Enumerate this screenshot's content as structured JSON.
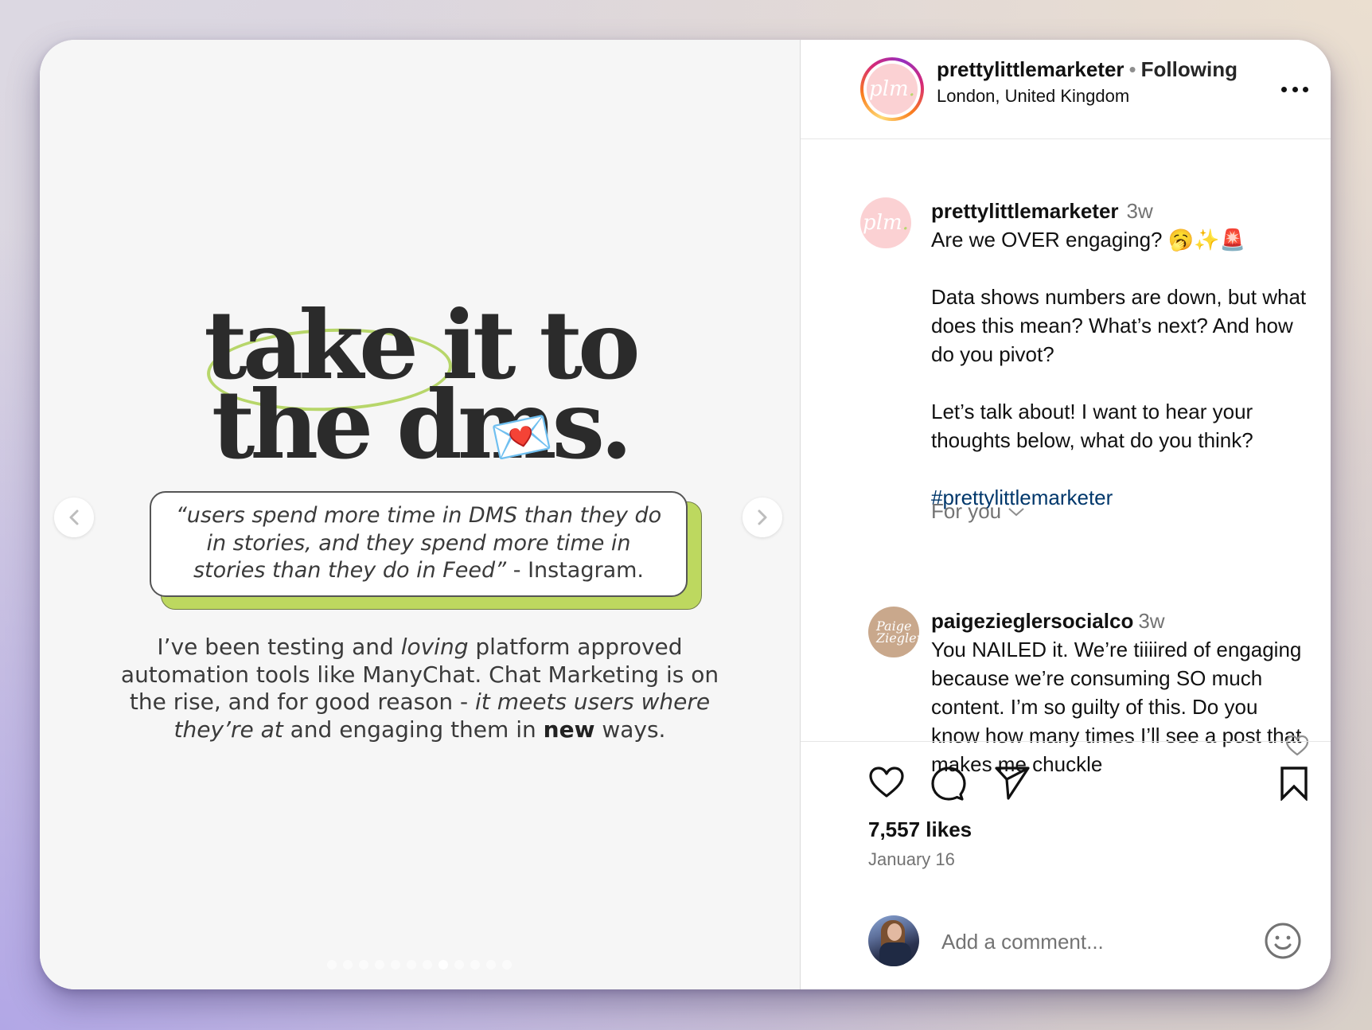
{
  "media": {
    "headline_line1": "take it to",
    "headline_line2": "the dms.",
    "sticker_emoji": "💌",
    "quote_text": "“users spend more time in DMS than they do in stories, and they spend more time in stories than they do in Feed”",
    "quote_attribution": " - Instagram.",
    "body_parts": [
      {
        "text": "I’ve been testing and ",
        "style": "normal"
      },
      {
        "text": "loving",
        "style": "italic"
      },
      {
        "text": " platform approved automation tools like ManyChat. Chat Marketing is on the rise, and for good reason - ",
        "style": "normal"
      },
      {
        "text": "it meets users where they’re at",
        "style": "italic"
      },
      {
        "text": " and engaging them in ",
        "style": "normal"
      },
      {
        "text": "new",
        "style": "bold"
      },
      {
        "text": " ways.",
        "style": "normal"
      }
    ],
    "carousel": {
      "total_slides": 12,
      "current_slide": 8
    },
    "prev_icon": "chevron-left-icon",
    "next_icon": "chevron-right-icon"
  },
  "header": {
    "avatar_text": "plm",
    "username": "prettylittlemarketer",
    "separator": "•",
    "follow_status": "Following",
    "location": "London, United Kingdom",
    "more_icon": "more-horizontal-icon"
  },
  "caption": {
    "avatar_text": "plm",
    "username": "prettylittlemarketer",
    "time": "3w",
    "line1": "Are we OVER engaging? 🥱✨🚨",
    "para2": "Data shows numbers are down, but what does this mean? What’s next? And how do you pivot?",
    "para3": "Let’s talk about! I want to hear your thoughts below, what do you think?",
    "hashtag": "#prettylittlemarketer"
  },
  "sort": {
    "label": "For you",
    "icon": "chevron-down-icon"
  },
  "comments": [
    {
      "avatar_text": "Paige Ziegler",
      "username": "paigezieglersocialco",
      "time": "3w",
      "text": "You NAILED it. We’re tiiiired of engaging because we’re consuming SO much content. I’m so guilty of this. Do you know how many times I’ll see a post that makes me chuckle"
    }
  ],
  "actions": {
    "like_icon": "heart-icon",
    "comment_icon": "comment-icon",
    "share_icon": "send-icon",
    "save_icon": "bookmark-icon",
    "likes": "7,557 likes",
    "date": "January 16"
  },
  "add_comment": {
    "placeholder": "Add a comment...",
    "value": "",
    "emoji_icon": "emoji-icon"
  },
  "colors": {
    "accent_green": "#b7d66a",
    "hashtag_blue": "#00376b",
    "avatar_pink": "#fbd1d3",
    "avatar_tan": "#c9a88c"
  }
}
